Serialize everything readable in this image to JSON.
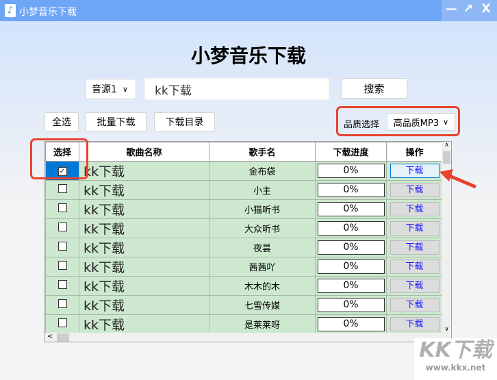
{
  "window": {
    "title": "小梦音乐下载",
    "minimize": "—",
    "maximize": "↗",
    "close": "X",
    "icon": "music-note-icon"
  },
  "heading": "小梦音乐下载",
  "search": {
    "source": "音源1",
    "query": "kk下载",
    "button": "搜索"
  },
  "toolbar": {
    "select_all": "全选",
    "batch_download": "批量下载",
    "download_dir": "下载目录",
    "quality_label": "品质选择",
    "quality_value": "高品质MP3"
  },
  "table": {
    "headers": [
      "选择",
      "歌曲名称",
      "歌手名",
      "下载进度",
      "操作"
    ],
    "rows": [
      {
        "checked": true,
        "song": "kk下载",
        "artist": "金布袋",
        "progress": "0%",
        "action": "下载"
      },
      {
        "checked": false,
        "song": "kk下载",
        "artist": "小主",
        "progress": "0%",
        "action": "下载"
      },
      {
        "checked": false,
        "song": "kk下载",
        "artist": "小猫听书",
        "progress": "0%",
        "action": "下载"
      },
      {
        "checked": false,
        "song": "kk下载",
        "artist": "大众听书",
        "progress": "0%",
        "action": "下载"
      },
      {
        "checked": false,
        "song": "kk下载",
        "artist": "夜昙",
        "progress": "0%",
        "action": "下载"
      },
      {
        "checked": false,
        "song": "kk下载",
        "artist": "茜茜吖",
        "progress": "0%",
        "action": "下载"
      },
      {
        "checked": false,
        "song": "kk下载",
        "artist": "木木的木",
        "progress": "0%",
        "action": "下载"
      },
      {
        "checked": false,
        "song": "kk下载",
        "artist": "七雪传媒",
        "progress": "0%",
        "action": "下载"
      },
      {
        "checked": false,
        "song": "kk下载",
        "artist": "是莱莱呀",
        "progress": "0%",
        "action": "下载"
      }
    ]
  },
  "watermark": {
    "logo": "KK下载",
    "url": "www.kkx.net"
  }
}
